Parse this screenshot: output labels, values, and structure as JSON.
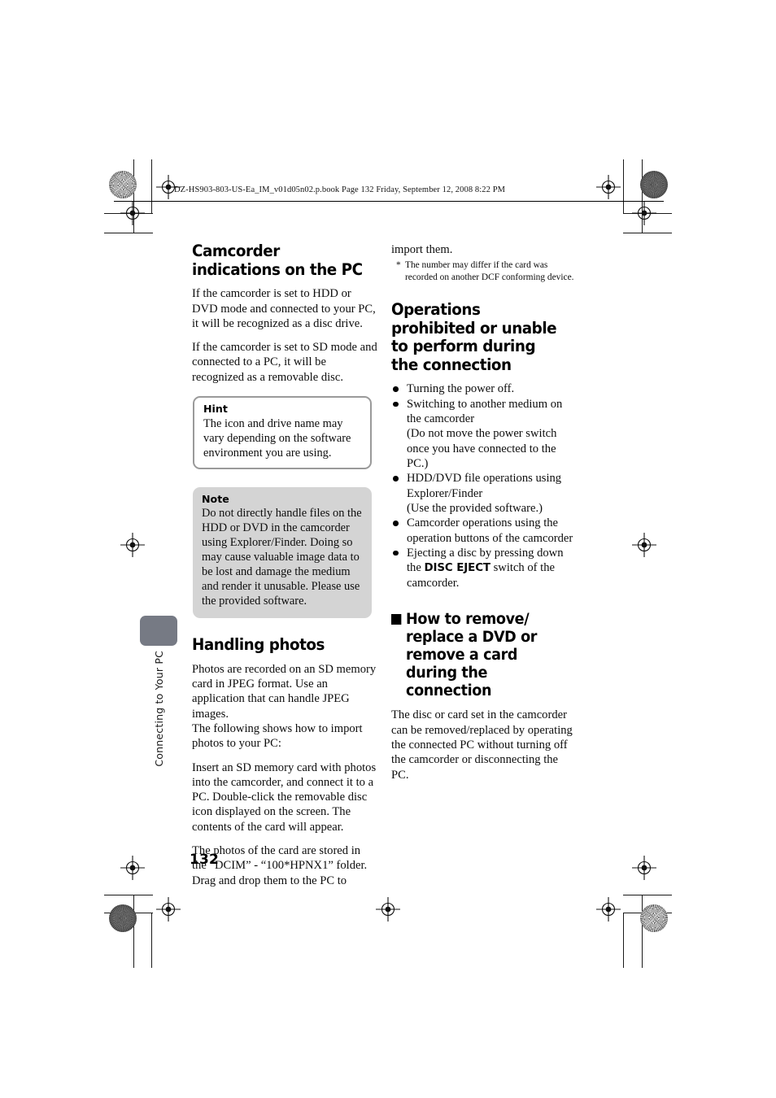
{
  "print_header": {
    "text": "DZ-HS903-803-US-Ea_IM_v01d05n02.p.book  Page 132  Friday, September 12, 2008  8:22 PM"
  },
  "folio": {
    "page_number": "132"
  },
  "side_tab": {
    "chapter_label": "Connecting to Your PC"
  },
  "left_column": {
    "heading": "Camcorder indications on the PC",
    "paragraphs": [
      "If the camcorder is set to HDD or DVD mode and connected to your PC, it will be recognized as a disc drive.",
      "If the camcorder is set to SD mode and connected to a PC, it will be recognized as a removable disc."
    ],
    "hint_box": {
      "label": "Hint",
      "text": "The icon and drive name may vary depending on the software environment you are using."
    },
    "note_box": {
      "label": "Note",
      "text": "Do not directly handle files on the HDD or DVD in the camcorder using Explorer/Finder. Doing so may cause valuable image data to be lost and damage the medium and render it unusable. Please use the provided software."
    },
    "heading2": "Handling photos",
    "paragraphs2": [
      "Photos are recorded on an SD memory card in JPEG format. Use an application that can handle JPEG images.",
      "The following shows how to import photos to your PC:",
      "Insert an SD memory card with photos into the camcorder, and connect it to a PC. Double-click the removable disc icon displayed on the screen. The contents of the card will appear.",
      "The photos of the card are stored in the “DCIM” - “100*HPNX1” folder. Drag and drop them to the PC to"
    ]
  },
  "right_column": {
    "continued_text": "import them.",
    "footnote": {
      "marker": "*",
      "text": "The number may differ if the card was recorded on another DCF conforming device."
    },
    "heading": "Operations prohibited or unable to perform during the connection",
    "bullets": [
      {
        "text": "Turning the power off."
      },
      {
        "text": "Switching to another medium on the camcorder\n(Do not move the power switch once you have connected to the PC.)"
      },
      {
        "text": "HDD/DVD file operations using Explorer/Finder\n(Use the provided software.)"
      },
      {
        "text": "Camcorder operations using the operation buttons of the camcorder"
      },
      {
        "text_before": "Ejecting a disc by pressing down the ",
        "emphasis": "DISC EJECT",
        "text_after": " switch of the camcorder."
      }
    ],
    "subheading": "How to remove/ replace a DVD or remove a card during the connection",
    "paragraph": "The disc or card set in the camcorder can be removed/replaced by operating the connected PC without turning off the camcorder or disconnecting the PC."
  },
  "colors": {
    "tab_gray": "#767a84",
    "note_fill": "#d4d4d4",
    "hint_border": "#9a9a9a",
    "text": "#0d0d0d"
  }
}
